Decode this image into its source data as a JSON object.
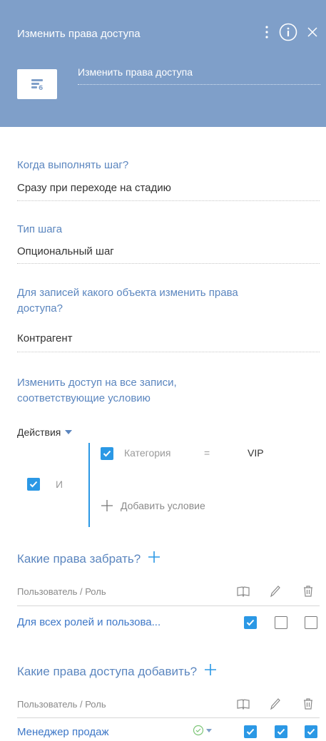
{
  "header": {
    "title": "Изменить права доступа",
    "step_name": "Изменить права доступа",
    "background_color": "#7f9fc9"
  },
  "fields": {
    "when": {
      "label": "Когда выполнять шаг?",
      "value": "Сразу при переходе на стадию"
    },
    "step_type": {
      "label": "Тип шага",
      "value": "Опциональный шаг"
    },
    "object": {
      "label_line1": "Для записей какого объекта изменить права",
      "label_line2": "доступа?",
      "value": "Контрагент"
    },
    "condition": {
      "label_line1": "Изменить доступ на все записи,",
      "label_line2": "соответствующие условию"
    }
  },
  "filter": {
    "actions_label": "Действия",
    "group_operator": "И",
    "condition": {
      "column": "Категория",
      "operator": "=",
      "value": "VIP"
    },
    "add_condition_label": "Добавить условие"
  },
  "revoke": {
    "title": "Какие права забрать?",
    "column_header": "Пользователь / Роль",
    "rows": [
      {
        "name": "Для всех ролей и пользова...",
        "read": true,
        "edit": false,
        "delete": false
      }
    ]
  },
  "grant": {
    "title": "Какие права доступа добавить?",
    "column_header": "Пользователь / Роль",
    "rows": [
      {
        "name": "Менеджер продаж",
        "read": true,
        "edit": true,
        "delete": true
      }
    ]
  },
  "icons": {
    "menu": "dots-vertical-icon",
    "info": "info-icon",
    "close": "close-icon",
    "step": "change-access-rights-icon",
    "read": "book-icon",
    "edit": "pencil-icon",
    "delete": "trash-icon",
    "add": "plus-icon",
    "access_level": "check-circle-icon"
  },
  "colors": {
    "accent": "#2b98e5",
    "label": "#5b86bf",
    "link": "#3d77c7"
  }
}
